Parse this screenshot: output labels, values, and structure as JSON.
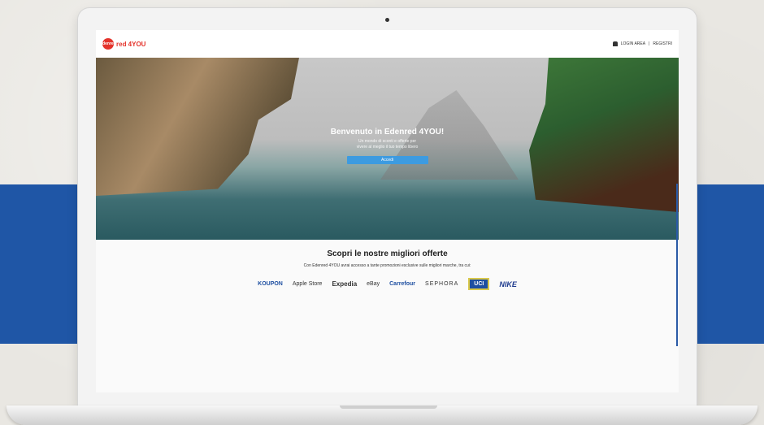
{
  "header": {
    "logo_mark": "edenred",
    "logo_text": "red 4YOU",
    "login_label": "LOGIN AREA",
    "separator": "|",
    "register_label": "REGISTRI"
  },
  "hero": {
    "title": "Benvenuto in Edenred 4YOU!",
    "subtitle_line1": "Un mondo di sconti e offerte per",
    "subtitle_line2": "vivere al meglio il tuo tempo libero",
    "button_label": "Accedi"
  },
  "offers": {
    "title": "Scopri le nostre migliori offerte",
    "subtitle": "Con Edenred 4YOU avrai accesso a tante promozioni esclusive sulle migliori marche, tra cui:",
    "brands": [
      "KOUPON",
      "Apple Store",
      "Expedia",
      "eBay",
      "Carrefour",
      "SEPHORA",
      "UCI",
      "NIKE"
    ]
  },
  "colors": {
    "accent_blue": "#1f56a6",
    "brand_red": "#e4332b"
  }
}
